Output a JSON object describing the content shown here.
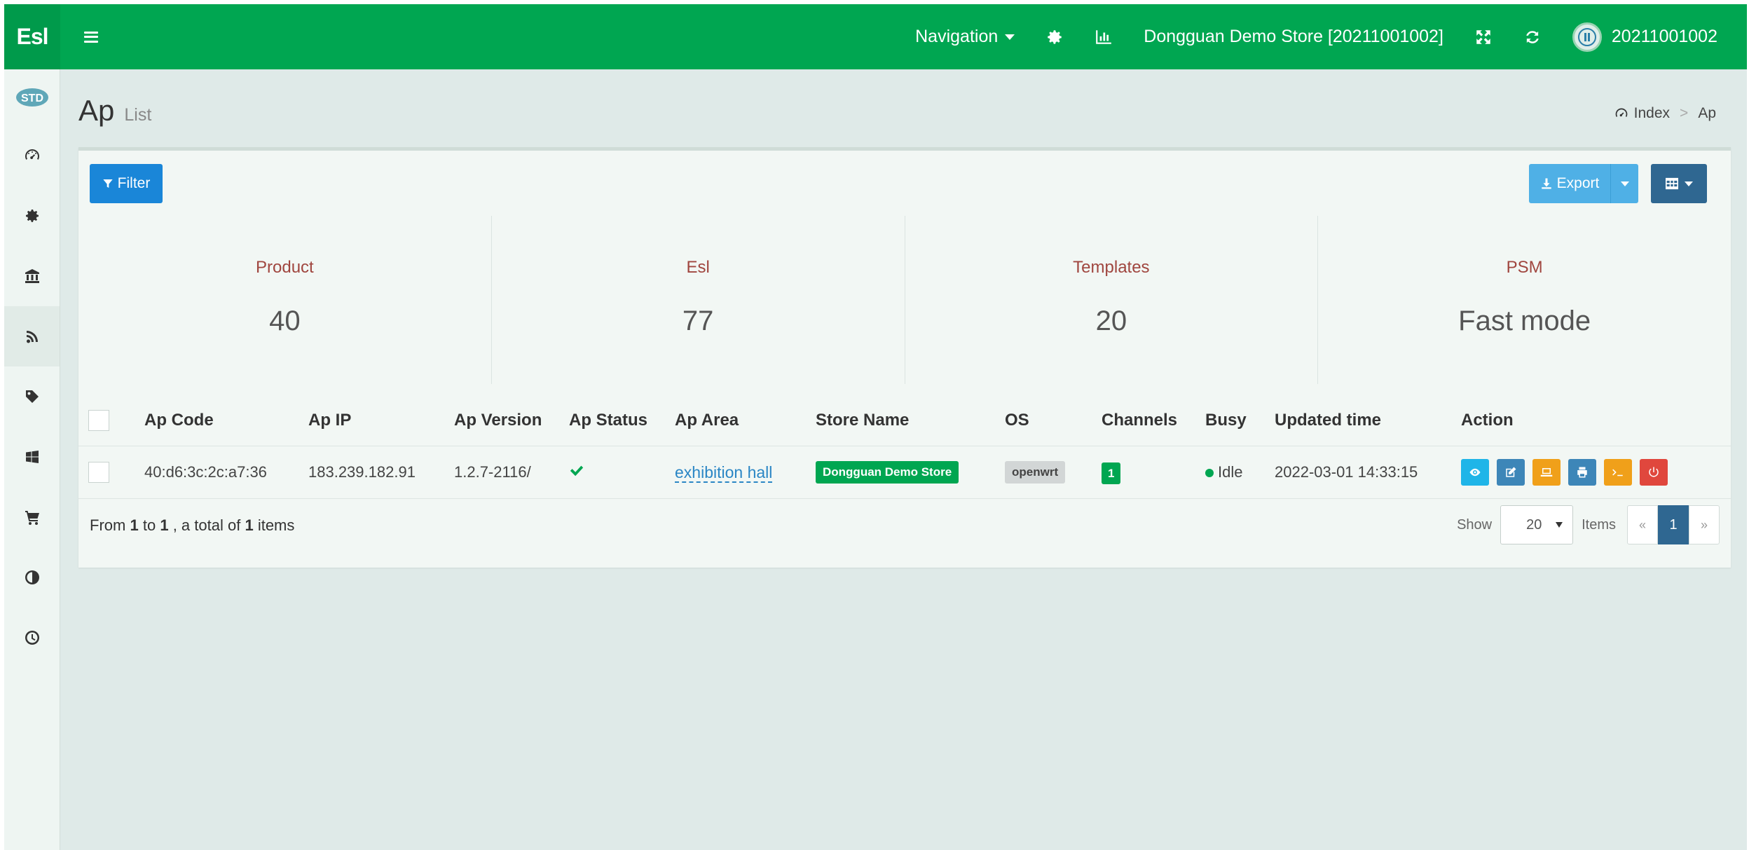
{
  "brand": "Esl",
  "topbar": {
    "navigation_label": "Navigation",
    "store_label": "Dongguan Demo Store [20211001002]",
    "user_label": "20211001002"
  },
  "page": {
    "title": "Ap",
    "subtitle": "List"
  },
  "breadcrumb": {
    "home": "Index",
    "separator": ">",
    "current": "Ap"
  },
  "toolbar": {
    "filter_label": "Filter",
    "export_label": "Export"
  },
  "stats": [
    {
      "label": "Product",
      "value": "40"
    },
    {
      "label": "Esl",
      "value": "77"
    },
    {
      "label": "Templates",
      "value": "20"
    },
    {
      "label": "PSM",
      "value": "Fast mode"
    }
  ],
  "table": {
    "columns": [
      "Ap Code",
      "Ap IP",
      "Ap Version",
      "Ap Status",
      "Ap Area",
      "Store Name",
      "OS",
      "Channels",
      "Busy",
      "Updated time",
      "Action"
    ],
    "rows": [
      {
        "ap_code": "40:d6:3c:2c:a7:36",
        "ap_ip": "183.239.182.91",
        "ap_version": "1.2.7-2116/",
        "ap_area": "exhibition hall",
        "store_name": "Dongguan Demo Store",
        "os": "openwrt",
        "channels": "1",
        "busy": "Idle",
        "updated_time": "2022-03-01 14:33:15"
      }
    ]
  },
  "pager": {
    "from_label": "From",
    "from": "1",
    "to_label": "to",
    "to": "1",
    "total_label": ", a total of",
    "total": "1",
    "items_label": "items",
    "show_label": "Show",
    "page_size": "20",
    "items_suffix": "Items",
    "prev": "«",
    "current_page": "1",
    "next": "»"
  },
  "colors": {
    "topbar": "#00a651",
    "accent_blue": "#1a86d8",
    "stat_label": "#a0463f"
  }
}
